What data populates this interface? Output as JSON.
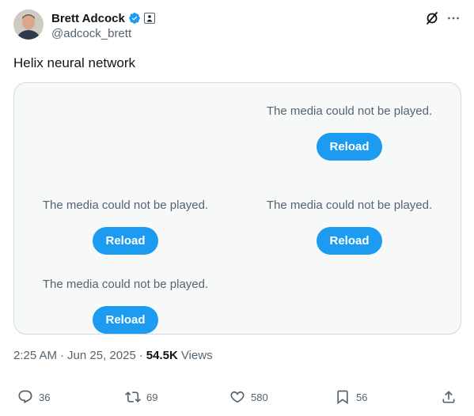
{
  "author": {
    "display_name": "Brett Adcock",
    "handle": "@adcock_brett"
  },
  "tweet": {
    "text": "Helix neural network"
  },
  "media": {
    "items": [
      {
        "message": "The media could not be played.",
        "button_label": "Reload"
      },
      {
        "message": "The media could not be played.",
        "button_label": "Reload"
      },
      {
        "message": "The media could not be played.",
        "button_label": "Reload"
      },
      {
        "message": "The media could not be played.",
        "button_label": "Reload"
      }
    ]
  },
  "meta": {
    "time": "2:25 AM",
    "separator": "·",
    "date": "Jun 25, 2025",
    "views_count": "54.5K",
    "views_label": "Views"
  },
  "actions": {
    "replies": "36",
    "reposts": "69",
    "likes": "580",
    "bookmarks": "56"
  },
  "icons": {
    "verified": "verified-badge-icon",
    "affiliate": "affiliate-badge-icon",
    "grok": "grok-icon",
    "more": "more-icon",
    "reply": "reply-icon",
    "repost": "repost-icon",
    "like": "heart-icon",
    "bookmark": "bookmark-icon",
    "share": "share-icon"
  },
  "colors": {
    "accent": "#1d9bf0",
    "text_primary": "#0f1419",
    "text_secondary": "#536471",
    "media_bg": "#f7f9f9",
    "border": "#cfd9de"
  }
}
